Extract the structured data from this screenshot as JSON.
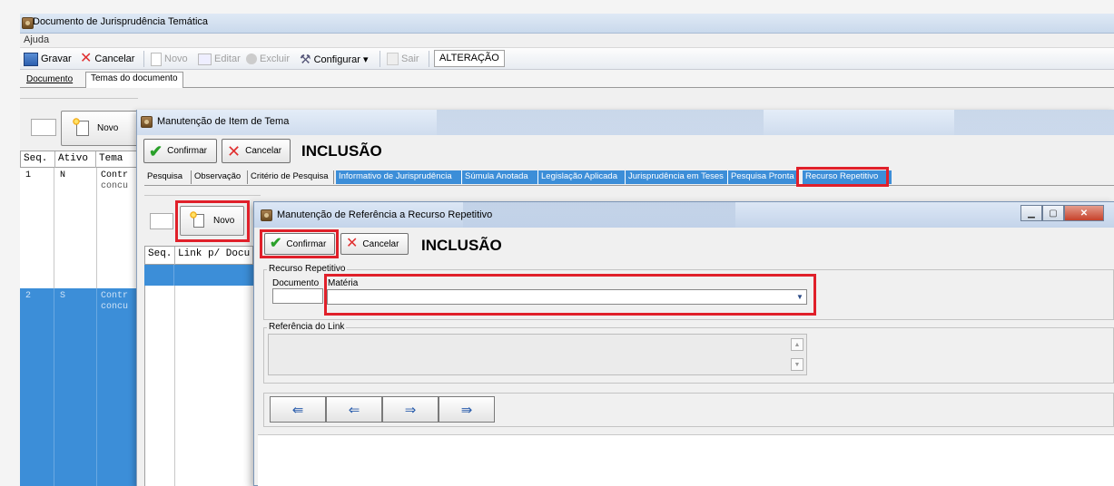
{
  "outer_window": {
    "title": "Documento de Jurisprudência Temática"
  },
  "menu": {
    "items": [
      "Ajuda"
    ]
  },
  "toolbar": {
    "gravar": "Gravar",
    "cancelar": "Cancelar",
    "novo": "Novo",
    "editar": "Editar",
    "excluir": "Excluir",
    "configurar": "Configurar ▾",
    "sair": "Sair",
    "mode": "ALTERAÇÃO"
  },
  "outer_tabs": [
    "Documento",
    "Temas do documento"
  ],
  "left_panel": {
    "novo_label": "Novo",
    "columns": [
      "Seq.",
      "Ativo",
      "Tema"
    ],
    "rows": [
      {
        "seq": "1",
        "ativo": "N",
        "tema": "Contr",
        "tema2": "concu"
      },
      {
        "seq": "2",
        "ativo": "S",
        "tema": "Contr",
        "tema2": "concu"
      }
    ]
  },
  "mid_window": {
    "title": "Manutenção de Item de Tema",
    "confirm_label": "Confirmar",
    "cancel_label": "Cancelar",
    "mode": "INCLUSÃO",
    "tabs": [
      "Pesquisa",
      "Observação",
      "Critério de Pesquisa",
      "Informativo de Jurisprudência",
      "Súmula Anotada",
      "Legislação Aplicada",
      "Jurisprudência em Teses",
      "Pesquisa Pronta",
      "Recurso Repetitivo"
    ],
    "novo_label": "Novo",
    "grid_columns": [
      "Seq.",
      "Link p/ Docu"
    ]
  },
  "inner_window": {
    "title": "Manutenção de Referência a Recurso Repetitivo",
    "confirm_label": "Confirmar",
    "cancel_label": "Cancelar",
    "mode": "INCLUSÃO",
    "group_recurso": "Recurso Repetitivo",
    "documento_label": "Documento",
    "documento_value": "",
    "materia_label": "Matéria",
    "materia_value": "",
    "group_referencia": "Referência do Link",
    "nav": [
      "⇚",
      "⇐",
      "⇒",
      "⇛"
    ]
  },
  "colors": {
    "highlight": "#e0202a",
    "selection": "#3c8ed8",
    "confirm_check": "#2aa02a",
    "cancel_x": "#e03030"
  }
}
